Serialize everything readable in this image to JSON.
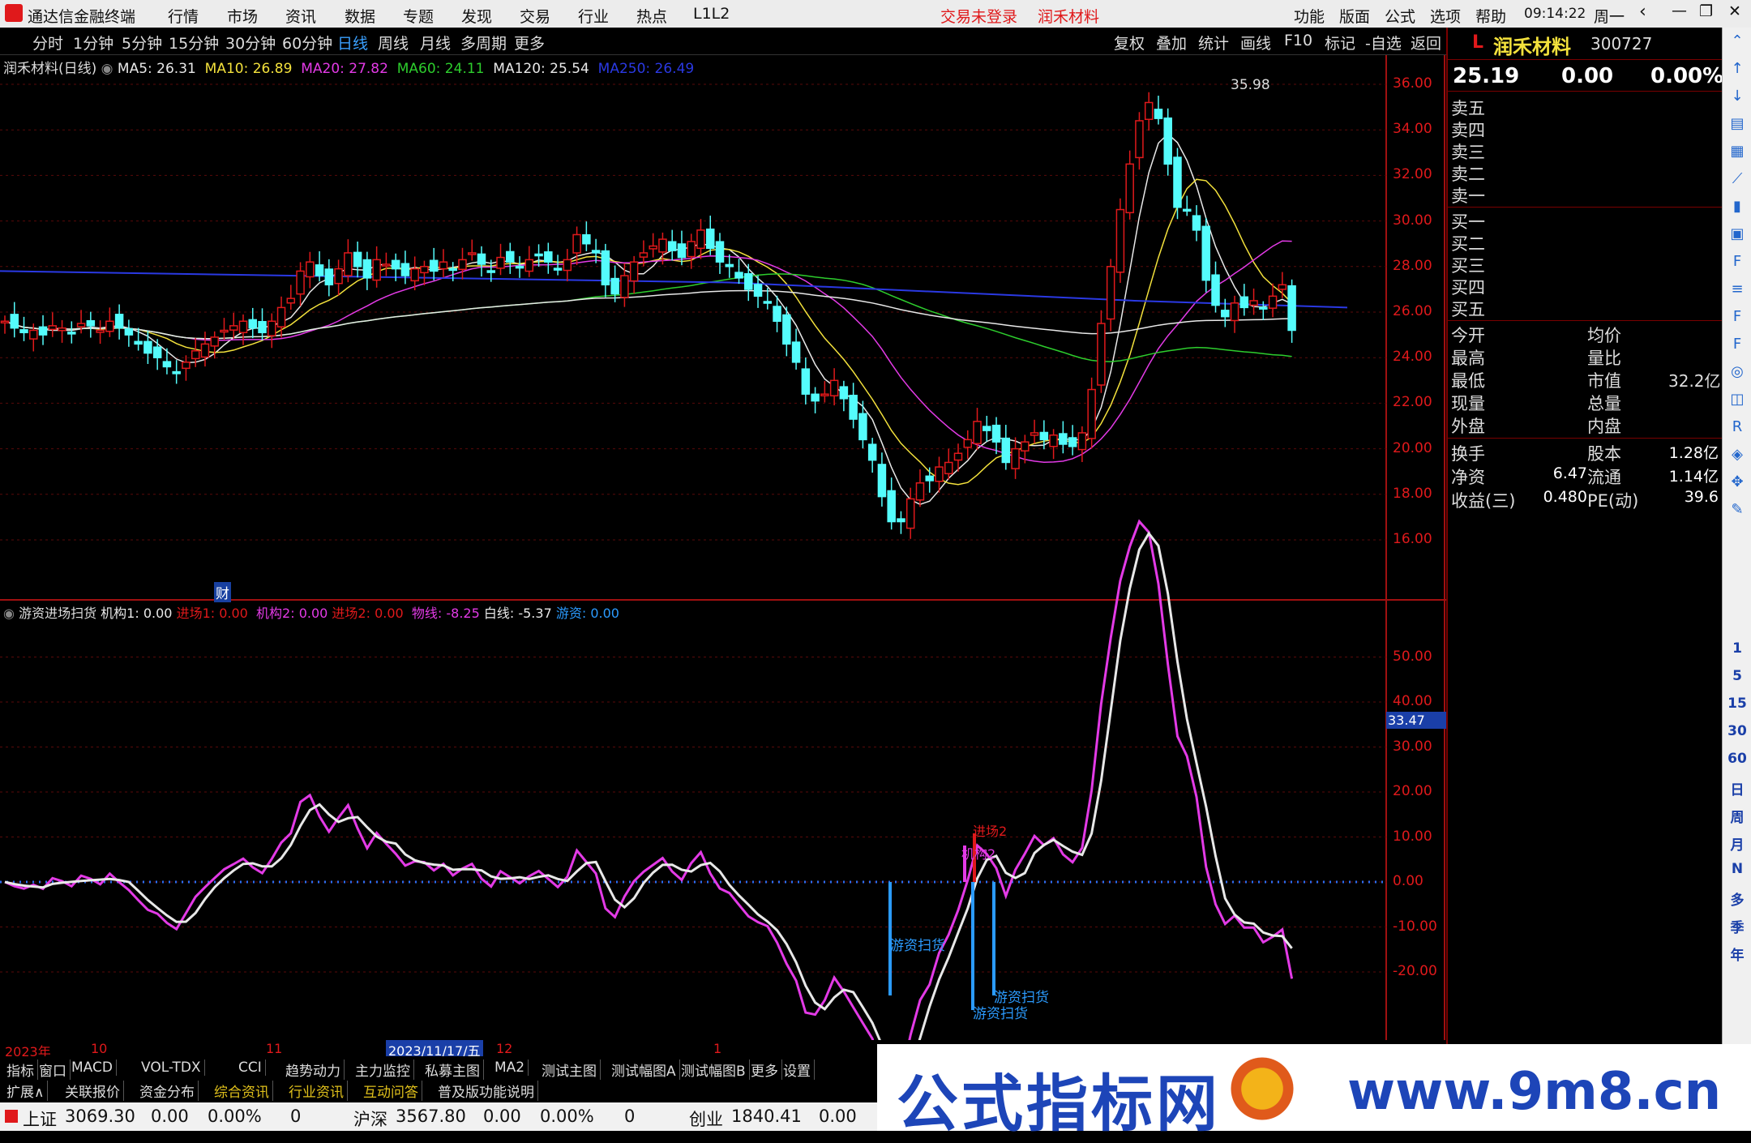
{
  "app_title": "通达信金融终端",
  "menu": [
    "行情",
    "市场",
    "资讯",
    "数据",
    "专题",
    "发现",
    "交易",
    "行业",
    "热点",
    "L1L2"
  ],
  "trade_status": "交易未登录",
  "stock_name": "润禾材料",
  "menu_right": [
    "功能",
    "版面",
    "公式",
    "选项",
    "帮助"
  ],
  "clock": "09:14:22",
  "weekday": "周一",
  "periods": [
    "分时",
    "1分钟",
    "5分钟",
    "15分钟",
    "30分钟",
    "60分钟",
    "日线",
    "周线",
    "月线",
    "多周期",
    "更多"
  ],
  "chart_tools": [
    "复权",
    "叠加",
    "统计",
    "画线",
    "F10",
    "标记",
    "-自选",
    "返回"
  ],
  "main_title": "润禾材料(日线)",
  "ma": [
    {
      "label": "MA5: 26.31",
      "color": "#e8e8e8"
    },
    {
      "label": "MA10: 26.89",
      "color": "#f3e13c"
    },
    {
      "label": "MA20: 27.82",
      "color": "#e33ae6"
    },
    {
      "label": "MA60: 24.11",
      "color": "#2dcd2d"
    },
    {
      "label": "MA120: 25.54",
      "color": "#e8e8e8"
    },
    {
      "label": "MA250: 26.49",
      "color": "#2a39e3"
    }
  ],
  "price_ticks": [
    "36.00",
    "34.00",
    "32.00",
    "30.00",
    "28.00",
    "26.00",
    "24.00",
    "22.00",
    "20.00",
    "18.00",
    "16.00"
  ],
  "high_label": "35.98",
  "ind_title": "游资进场扫货",
  "ind_legend": [
    {
      "label": "机构1: 0.00",
      "color": "#e8e8e8"
    },
    {
      "label": "进场1: 0.00",
      "color": "#e0191b"
    },
    {
      "label": "机构2: 0.00",
      "color": "#e33ae6"
    },
    {
      "label": "进场2: 0.00",
      "color": "#e0191b"
    },
    {
      "label": "物线: -8.25",
      "color": "#e33ae6"
    },
    {
      "label": "白线: -5.37",
      "color": "#e8e8e8"
    },
    {
      "label": "游资: 0.00",
      "color": "#2b9bff"
    }
  ],
  "ind_ticks": [
    "50.00",
    "40.00",
    "30.00",
    "20.00",
    "10.00",
    "0.00",
    "-10.00",
    "-20.00"
  ],
  "ind_cursor": "33.47",
  "signals": {
    "jc2": "进场2",
    "jg2": "机构2",
    "yz1": "游资扫货",
    "yz2": "游资扫货",
    "yz3": "游资扫货"
  },
  "fin_mark": "财",
  "date_axis": [
    "2023年",
    "10",
    "11",
    "2023/11/17/五",
    "12",
    "1"
  ],
  "tabs1": [
    "指标",
    "窗口",
    "MACD",
    "VOL-TDX",
    "CCI",
    "趋势动力",
    "主力监控",
    "私募主图",
    "MA2",
    "测试主图",
    "测试幅图A",
    "测试幅图B",
    "更多",
    "设置"
  ],
  "tabs2": [
    "扩展∧",
    "关联报价",
    "资金分布",
    "综合资讯",
    "行业资讯",
    "互动问答",
    "普及版功能说明"
  ],
  "quote": {
    "flag": "L",
    "name": "润禾材料",
    "code": "300727",
    "price": "25.19",
    "change": "0.00",
    "pct": "0.00%",
    "sell": [
      "卖五",
      "卖四",
      "卖三",
      "卖二",
      "卖一"
    ],
    "buy": [
      "买一",
      "买二",
      "买三",
      "买四",
      "买五"
    ],
    "left": [
      "今开",
      "最高",
      "最低",
      "现量",
      "外盘"
    ],
    "right": [
      "均价",
      "量比",
      "市值",
      "总量",
      "内盘"
    ],
    "mktcap": "32.2亿",
    "rows": [
      {
        "l": "换手",
        "lv": "",
        "r": "股本",
        "rv": "1.28亿"
      },
      {
        "l": "净资",
        "lv": "6.47",
        "r": "流通",
        "rv": "1.14亿"
      },
      {
        "l": "收益(三)",
        "lv": "0.480",
        "r": "PE(动)",
        "rv": "39.6"
      }
    ]
  },
  "status": {
    "sh_label": "上证",
    "sh_val": "3069.30",
    "sh_chg": "0.00",
    "sh_pct": "0.00%",
    "sh_vol": "0",
    "hs_label": "沪深",
    "hs_val": "3567.80",
    "hs_chg": "0.00",
    "hs_pct": "0.00%",
    "hs_vol": "0",
    "cy_label": "创业",
    "cy_val": "1840.41",
    "cy_chg": "0.00"
  },
  "watermark": {
    "text1": "公式指标网",
    "text2": "www.9m8.cn"
  },
  "side_labels": [
    "1",
    "5",
    "15",
    "30",
    "60",
    "日",
    "周",
    "月",
    "N",
    "多",
    "季",
    "年"
  ],
  "chart_data": {
    "type": "candlestick",
    "ylim": [
      15,
      37
    ],
    "close": [
      25.6,
      25.3,
      25.1,
      25.2,
      25.0,
      25.4,
      25.3,
      25.1,
      25.5,
      25.4,
      25.2,
      25.6,
      25.3,
      25.0,
      24.6,
      24.2,
      24.0,
      23.6,
      23.3,
      23.8,
      24.3,
      24.6,
      24.9,
      25.2,
      25.4,
      25.6,
      25.3,
      25.1,
      25.6,
      26.2,
      26.6,
      27.8,
      28.2,
      27.6,
      27.2,
      27.9,
      28.6,
      28.0,
      27.5,
      28.3,
      28.1,
      27.9,
      27.6,
      27.9,
      28.0,
      27.8,
      28.2,
      27.9,
      28.3,
      28.6,
      28.1,
      27.8,
      28.4,
      28.2,
      28.0,
      28.3,
      28.5,
      28.2,
      27.9,
      28.3,
      29.4,
      29.0,
      28.6,
      27.2,
      26.8,
      27.6,
      28.2,
      28.6,
      28.9,
      29.2,
      28.7,
      28.4,
      29.1,
      29.6,
      28.8,
      28.2,
      28.0,
      27.5,
      27.0,
      26.7,
      26.4,
      25.6,
      24.6,
      23.8,
      22.4,
      22.1,
      22.4,
      23.0,
      22.2,
      21.3,
      20.4,
      19.5,
      17.9,
      16.8,
      16.8,
      17.8,
      18.5,
      18.6,
      19.2,
      19.4,
      19.8,
      20.4,
      21.2,
      20.8,
      20.3,
      19.4,
      20.0,
      20.3,
      20.7,
      20.4,
      20.6,
      20.2,
      20.1,
      20.7,
      22.6,
      25.5,
      28.0,
      30.5,
      32.5,
      34.4,
      35.2,
      34.5,
      32.5,
      30.6,
      30.5,
      29.6,
      27.4,
      26.3,
      25.8,
      26.4,
      26.2,
      26.5,
      26.2,
      26.7,
      27.2,
      25.2
    ]
  }
}
